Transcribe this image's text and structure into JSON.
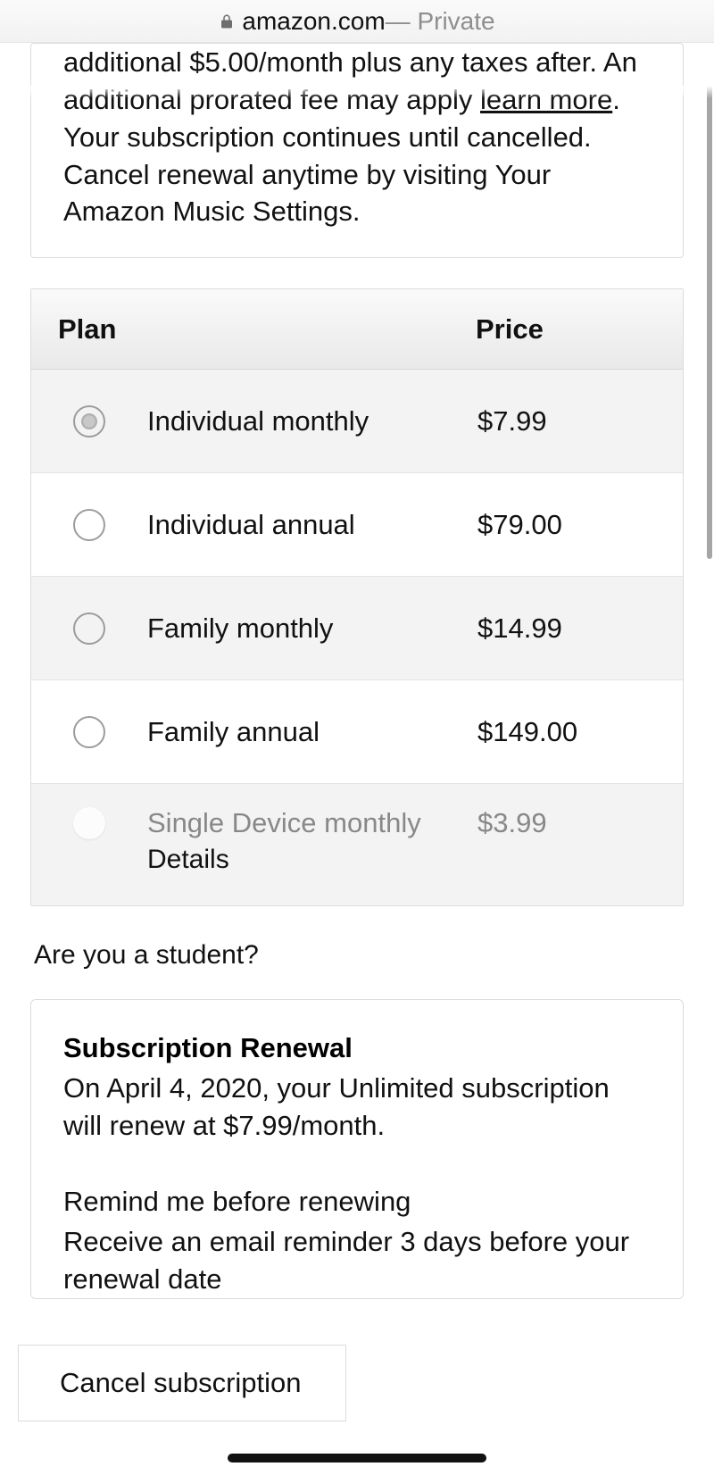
{
  "browser": {
    "domain": "amazon.com",
    "private_label": " — Private"
  },
  "info_card": {
    "text_pre": "additional $5.00/month plus any taxes after. An additional prorated fee may apply ",
    "link": "learn more",
    "text_post": ". Your subscription continues until cancelled. Cancel renewal anytime by visiting Your Amazon Music Settings."
  },
  "table": {
    "plan_header": "Plan",
    "price_header": "Price",
    "rows": [
      {
        "label": "Individual monthly",
        "price": "$7.99",
        "selected": true,
        "alt": true,
        "disabled": false
      },
      {
        "label": "Individual annual",
        "price": "$79.00",
        "selected": false,
        "alt": false,
        "disabled": false
      },
      {
        "label": "Family monthly",
        "price": "$14.99",
        "selected": false,
        "alt": true,
        "disabled": false
      },
      {
        "label": "Family annual",
        "price": "$149.00",
        "selected": false,
        "alt": false,
        "disabled": false
      },
      {
        "label": "Single Device monthly",
        "price": "$3.99",
        "selected": false,
        "alt": true,
        "disabled": true,
        "details": "Details"
      }
    ]
  },
  "student_prompt": "Are you a student?",
  "renewal": {
    "title": "Subscription Renewal",
    "text": "On April 4, 2020, your Unlimited subscription will renew at $7.99/month.",
    "remind_title": "Remind me before renewing",
    "remind_text": "Receive an email reminder 3 days before your renewal date"
  },
  "cancel_btn": "Cancel subscription"
}
